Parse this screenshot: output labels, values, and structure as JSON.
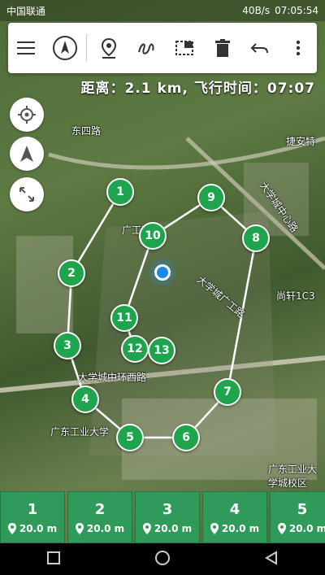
{
  "status_bar": {
    "carrier": "中国联通",
    "speed": "40B/s",
    "time_text": "07:05:54"
  },
  "toolbar": {
    "icons": [
      "menu-icon",
      "compass-icon",
      "waypoint-pin-icon",
      "freehand-path-icon",
      "select-area-icon",
      "delete-icon",
      "undo-icon",
      "more-icon"
    ]
  },
  "flight_info": "距离：2.1 km, 飞行时间：07:07",
  "map_labels": {
    "road_dongsi": "东四路",
    "road_daxuecheng": "大学城中环西路",
    "univ": "广东工业大学",
    "university_campus": "广东工业大学城校区",
    "hospital": "广工医院",
    "dorm": "尚轩1C3",
    "road_east": "大学城中心路",
    "road_middle": "大学城广工路",
    "poi_top": "捷安特"
  },
  "waypoints": [
    {
      "label": "1"
    },
    {
      "label": "2"
    },
    {
      "label": "3"
    },
    {
      "label": "4"
    },
    {
      "label": "5"
    },
    {
      "label": "6"
    },
    {
      "label": "7"
    },
    {
      "label": "8"
    },
    {
      "label": "9"
    },
    {
      "label": "10"
    },
    {
      "label": "11"
    },
    {
      "label": "12"
    },
    {
      "label": "13"
    }
  ],
  "cards": [
    {
      "num": "1",
      "alt": "20.0 m"
    },
    {
      "num": "2",
      "alt": "20.0 m"
    },
    {
      "num": "3",
      "alt": "20.0 m"
    },
    {
      "num": "4",
      "alt": "20.0 m"
    },
    {
      "num": "5",
      "alt": "20.0 m"
    }
  ],
  "colors": {
    "waypoint": "#1fa44e",
    "card": "#2f9a5a",
    "location": "#1e88e5"
  }
}
